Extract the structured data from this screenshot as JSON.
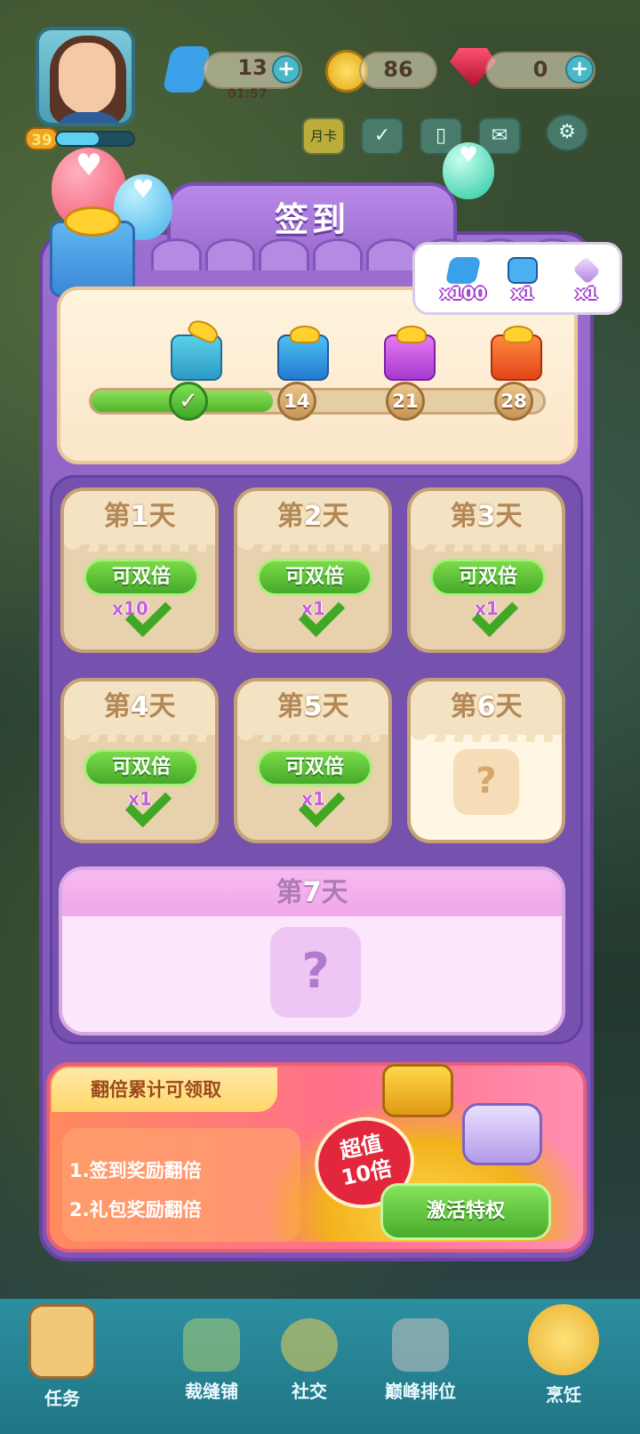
{
  "hud": {
    "level": "39",
    "energy": "13",
    "energy_timer": "01:57",
    "coins": "86",
    "gems": "0",
    "plus": "+",
    "monthly_card": "月卡"
  },
  "panel": {
    "title": "签到",
    "progress": {
      "fraction": 0.33,
      "milestones": [
        "14",
        "21",
        "28"
      ]
    },
    "tooltip_items": [
      {
        "icon": "energy-bolt-icon",
        "qty": "x100"
      },
      {
        "icon": "blue-chest-icon",
        "qty": "x1"
      },
      {
        "icon": "gem-crystal-icon",
        "qty": "x1"
      }
    ],
    "days": [
      {
        "prefix": "第",
        "num": "1",
        "suffix": "天",
        "double": "可双倍",
        "qty": "x10",
        "claimed": true
      },
      {
        "prefix": "第",
        "num": "2",
        "suffix": "天",
        "double": "可双倍",
        "qty": "x1",
        "claimed": true
      },
      {
        "prefix": "第",
        "num": "3",
        "suffix": "天",
        "double": "可双倍",
        "qty": "x1",
        "claimed": true
      },
      {
        "prefix": "第",
        "num": "4",
        "suffix": "天",
        "double": "可双倍",
        "qty": "x1",
        "claimed": true
      },
      {
        "prefix": "第",
        "num": "5",
        "suffix": "天",
        "double": "可双倍",
        "qty": "x1",
        "claimed": true
      },
      {
        "prefix": "第",
        "num": "6",
        "suffix": "天",
        "mystery": "?",
        "claimed": false
      }
    ],
    "day7": {
      "prefix": "第",
      "num": "7",
      "suffix": "天",
      "mystery": "?"
    },
    "promo": {
      "tab": "翻倍累计可领取",
      "line1": "1.签到奖励翻倍",
      "line2": "2.礼包奖励翻倍",
      "badge_line1": "超值",
      "badge_line2": "10倍",
      "button": "激活特权"
    }
  },
  "nav": [
    {
      "label": "任务",
      "icon": "task-clipboard-icon"
    },
    {
      "label": "裁缝铺",
      "icon": "sewing-icon"
    },
    {
      "label": "社交",
      "icon": "social-duck-icon"
    },
    {
      "label": "巅峰排位",
      "icon": "trophy-lock-icon"
    },
    {
      "label": "烹饪",
      "icon": "cooking-pot-icon"
    }
  ],
  "colors": {
    "panel": "#8a5ec0",
    "green": "#4fb52a",
    "accent": "#e2263c"
  }
}
